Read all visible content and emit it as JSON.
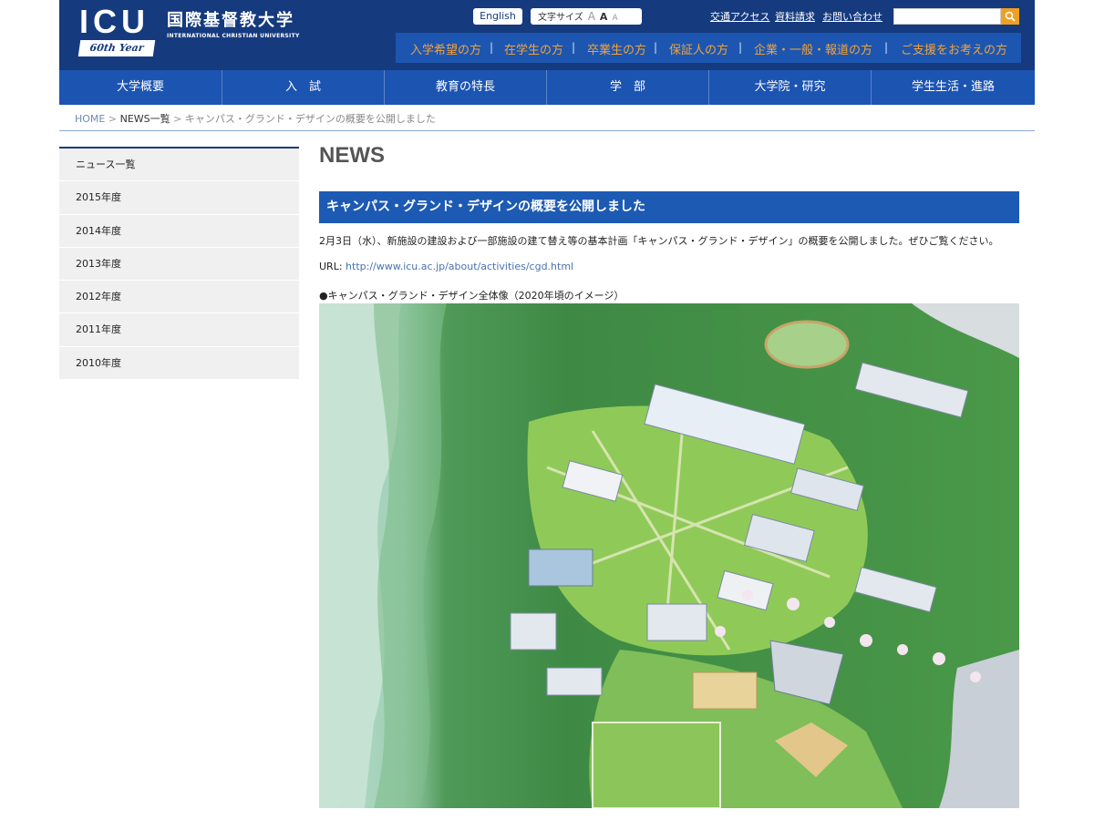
{
  "header": {
    "logo_mark": "ICU",
    "logo_badge": "60th Year",
    "logo_name_jp": "国際基督教大学",
    "logo_name_en": "INTERNATIONAL CHRISTIAN UNIVERSITY",
    "english_label": "English",
    "fontsize_label": "文字サイズ",
    "fontsize_options": [
      "A",
      "A",
      "A"
    ],
    "links": [
      "交通アクセス",
      "資料請求",
      "お問い合わせ"
    ],
    "search_placeholder": ""
  },
  "audience_nav": [
    "入学希望の方",
    "在学生の方",
    "卒業生の方",
    "保証人の方",
    "企業・一般・報道の方",
    "ご支援をお考えの方"
  ],
  "audience_separator": "|",
  "main_nav": [
    "大学概要",
    "入　試",
    "教育の特長",
    "学　部",
    "大学院・研究",
    "学生生活・進路"
  ],
  "breadcrumb": {
    "home": "HOME",
    "separator": ">",
    "news": "NEWS一覧",
    "current": "キャンパス・グランド・デザインの概要を公開しました"
  },
  "sidebar": [
    "ニュース一覧",
    "2015年度",
    "2014年度",
    "2013年度",
    "2012年度",
    "2011年度",
    "2010年度"
  ],
  "article": {
    "section": "NEWS",
    "title": "キャンパス・グランド・デザインの概要を公開しました",
    "body": "2月3日（水）、新施設の建設および一部施設の建て替え等の基本計画「キャンパス・グランド・デザイン」の概要を公開しました。ぜひご覧ください。",
    "url_label": "URL:",
    "url": "http://www.icu.ac.jp/about/activities/cgd.html",
    "caption": "●キャンパス・グランド・デザイン全体像（2020年頃のイメージ）"
  },
  "colors": {
    "header_navy": "#163a7e",
    "nav_blue": "#1c54b2",
    "audience_orange": "#f2a23a"
  }
}
